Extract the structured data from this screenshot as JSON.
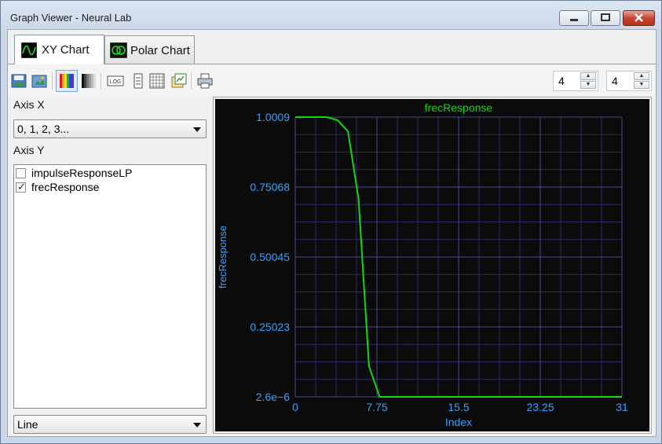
{
  "window": {
    "title": "Graph Viewer - Neural Lab"
  },
  "tabs": [
    {
      "label": "XY Chart",
      "icon": "xy-chart-icon",
      "active": true
    },
    {
      "label": "Polar Chart",
      "icon": "polar-chart-icon",
      "active": false
    }
  ],
  "toolbar": {
    "icons": [
      "save-icon",
      "export-icon",
      "color-palette-icon",
      "grayscale-icon",
      "log-scale-icon",
      "scale-icon",
      "grid-icon",
      "copy-icon",
      "print-icon"
    ],
    "spinner_1": "4",
    "spinner_2": "4"
  },
  "axis_x": {
    "label": "Axis X",
    "selected": "0, 1, 2, 3..."
  },
  "axis_y": {
    "label": "Axis Y",
    "items": [
      {
        "label": "impulseResponseLP",
        "checked": false
      },
      {
        "label": "frecResponse",
        "checked": true
      }
    ]
  },
  "plot_type": {
    "selected": "Line"
  },
  "colors": {
    "line": "#12d812",
    "axis_text": "#3aa0ff",
    "plot_bg": "#0b0b0b",
    "grid": "#2b2b66"
  },
  "chart_data": {
    "type": "line",
    "title": "frecResponse",
    "xlabel": "Index",
    "ylabel": "frecResponse",
    "xlim": [
      0,
      31
    ],
    "ylim": [
      2.6e-06,
      1.0009
    ],
    "x_ticks": [
      "0",
      "7.75",
      "15.5",
      "23.25",
      "31"
    ],
    "y_ticks": [
      "1.0009",
      "0.75068",
      "0.50045",
      "0.25023",
      "2.6e−6"
    ],
    "grid": true,
    "series": [
      {
        "name": "frecResponse",
        "x": [
          0,
          1,
          2,
          3,
          4,
          5,
          6,
          7,
          8,
          9,
          10,
          11,
          12,
          13,
          14,
          15,
          16,
          17,
          18,
          19,
          20,
          21,
          22,
          23,
          24,
          25,
          26,
          27,
          28,
          29,
          30,
          31
        ],
        "values": [
          1.0009,
          1.0009,
          1.0009,
          1.0009,
          0.99,
          0.95,
          0.71,
          0.11,
          2.6e-06,
          2.6e-06,
          2.6e-06,
          2.6e-06,
          2.6e-06,
          2.6e-06,
          2.6e-06,
          2.6e-06,
          2.6e-06,
          2.6e-06,
          2.6e-06,
          2.6e-06,
          2.6e-06,
          2.6e-06,
          2.6e-06,
          2.6e-06,
          2.6e-06,
          2.6e-06,
          2.6e-06,
          2.6e-06,
          2.6e-06,
          2.6e-06,
          2.6e-06,
          2.6e-06
        ]
      }
    ]
  }
}
